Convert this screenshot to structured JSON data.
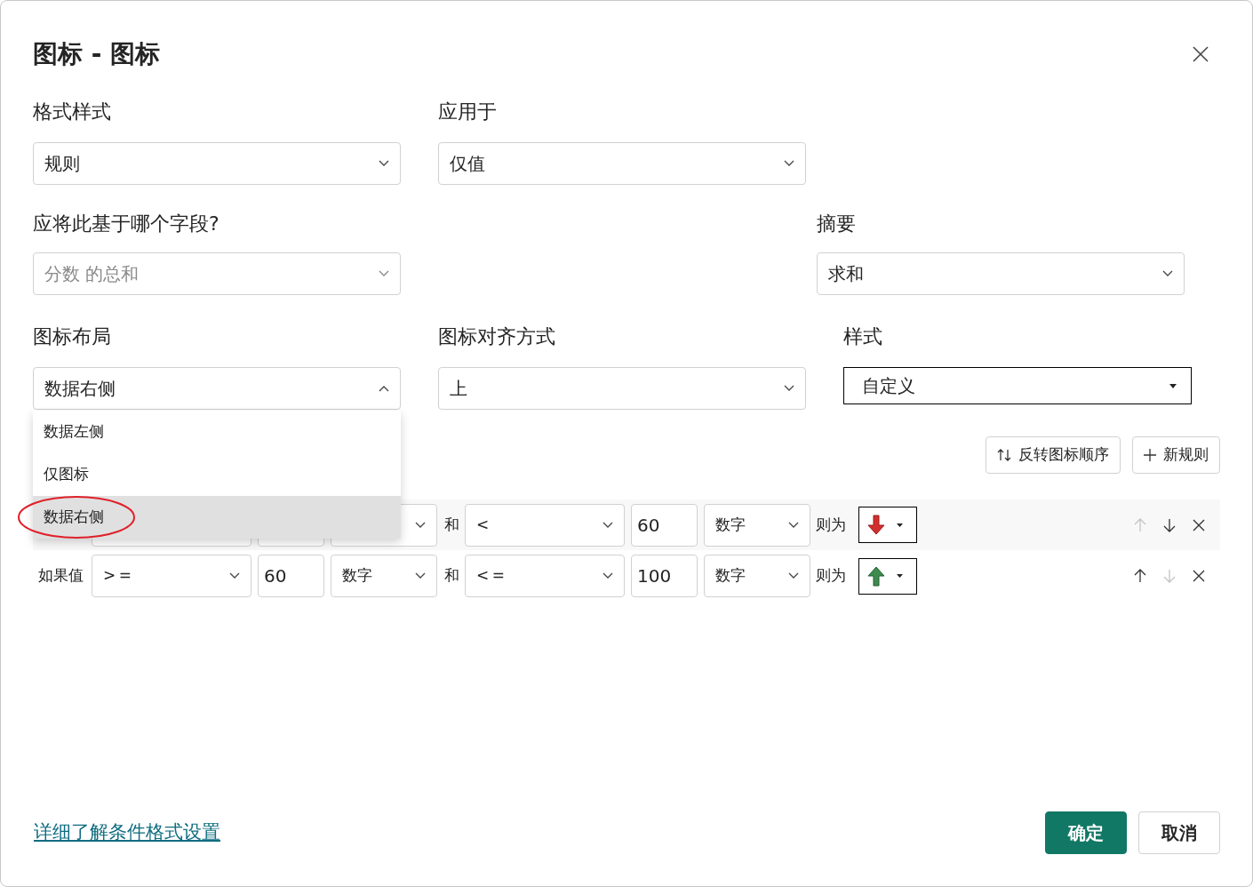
{
  "dialog": {
    "title": "图标 - 图标"
  },
  "format_style": {
    "label": "格式样式",
    "value": "规则"
  },
  "apply_to": {
    "label": "应用于",
    "value": "仅值"
  },
  "based_on_field": {
    "label": "应将此基于哪个字段?",
    "value": "分数 的总和",
    "disabled": true
  },
  "summary": {
    "label": "摘要",
    "value": "求和"
  },
  "icon_layout": {
    "label": "图标布局",
    "value": "数据右侧",
    "expanded": true,
    "options": [
      {
        "label": "数据左侧",
        "selected": false,
        "circled": false
      },
      {
        "label": "仅图标",
        "selected": false,
        "circled": false
      },
      {
        "label": "数据右侧",
        "selected": true,
        "circled": true
      }
    ]
  },
  "icon_alignment": {
    "label": "图标对齐方式",
    "value": "上"
  },
  "style": {
    "label": "样式",
    "value": "自定义"
  },
  "toolbar": [
    {
      "kind": "reverse",
      "label": "反转图标顺序"
    },
    {
      "kind": "add",
      "label": "新规则"
    }
  ],
  "rules": [
    {
      "highlighted": true,
      "kind": "arrow-down",
      "and_label": "和",
      "op2": "<",
      "value2": "60",
      "type2": "数字",
      "then_label": "则为",
      "move_up_disabled": true,
      "move_down_disabled": false
    },
    {
      "highlighted": false,
      "kind": "arrow-up",
      "if_label": "如果值",
      "op1": ">=",
      "value1": "60",
      "type1": "数字",
      "and_label": "和",
      "op2": "<=",
      "value2": "100",
      "type2": "数字",
      "then_label": "则为",
      "move_up_disabled": false,
      "move_down_disabled": true
    }
  ],
  "footer": {
    "link": "详细了解条件格式设置",
    "buttons": [
      {
        "label": "确定",
        "primary": true
      },
      {
        "label": "取消",
        "primary": false
      }
    ]
  }
}
